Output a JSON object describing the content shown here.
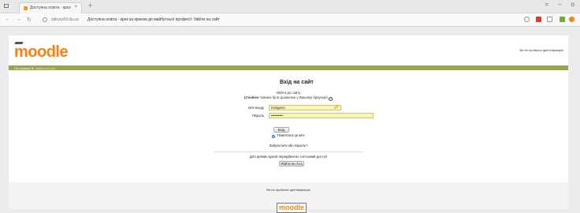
{
  "browser": {
    "tab_title": "Доступна освіта - крок",
    "tab_close": "×",
    "new_tab": "+",
    "window_controls": [
      "=",
      "–",
      "o"
    ],
    "url_host": "zplicey83.dp.ua",
    "url_title": "Доступна освіта - крок за кроком до майбутньої професії: Увійти на сайт",
    "nav_back": "←",
    "nav_forward": "→",
    "nav_reload": "↻"
  },
  "header": {
    "logo_text": "moodle",
    "login_status": "Ви не пройшли ідентифікацію"
  },
  "breadcrumb": {
    "home": "На головну",
    "separator": "►",
    "current": "Увійти на сайт"
  },
  "login": {
    "title": "Вхід на сайт",
    "intro_line1": "Увійти до сайту",
    "intro_cookies": "(Cookies",
    "intro_rest": " повинні бути дозволені у Вашому браузері)",
    "help_icon": "?",
    "username_label": "Ім'я входу",
    "username_value": "mosgeno",
    "password_label": "Пароль",
    "password_value": "••••••••••",
    "submit_label": "Вхід",
    "remember_label": "Пам'ятати це ім'я",
    "forgot_link": "Забули ім'я або пароль?",
    "guest_text": "Для деяких курсів передбачено гостьовий доступ",
    "guest_button": "Увійти як гість"
  },
  "footer": {
    "login_status": "Ви не пройшли ідентифікацію",
    "logo_text": "moodle"
  },
  "colors": {
    "accent": "#f98012",
    "navbar": "#9da14a",
    "field_bg": "#fbf6b0"
  }
}
